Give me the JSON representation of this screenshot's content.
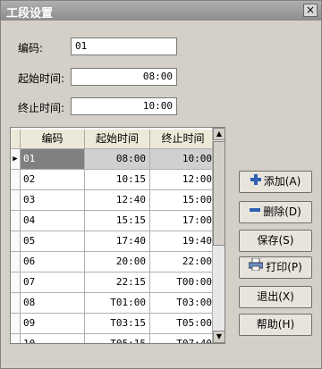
{
  "window": {
    "title": "工段设置",
    "close_glyph": "×"
  },
  "form": {
    "code_label": "编码:",
    "code_value": "01",
    "start_label": "起始时间:",
    "start_value": "08:00",
    "end_label": "终止时间:",
    "end_value": "10:00"
  },
  "table": {
    "headers": [
      "编码",
      "起始时间",
      "终止时间"
    ],
    "selected_index": 0,
    "row_marker": "▶",
    "rows": [
      [
        "01",
        "08:00",
        "10:00"
      ],
      [
        "02",
        "10:15",
        "12:00"
      ],
      [
        "03",
        "12:40",
        "15:00"
      ],
      [
        "04",
        "15:15",
        "17:00"
      ],
      [
        "05",
        "17:40",
        "19:40"
      ],
      [
        "06",
        "20:00",
        "22:00"
      ],
      [
        "07",
        "22:15",
        "T00:00"
      ],
      [
        "08",
        "T01:00",
        "T03:00"
      ],
      [
        "09",
        "T03:15",
        "T05:00"
      ],
      [
        "10",
        "T05:15",
        "T07:40"
      ]
    ]
  },
  "buttons": {
    "add": "添加(A)",
    "delete": "删除(D)",
    "save": "保存(S)",
    "print": "打印(P)",
    "exit": "退出(X)",
    "help": "帮助(H)"
  },
  "colors": {
    "selected_row": "#808080",
    "icon_blue": "#2f5fb3"
  }
}
